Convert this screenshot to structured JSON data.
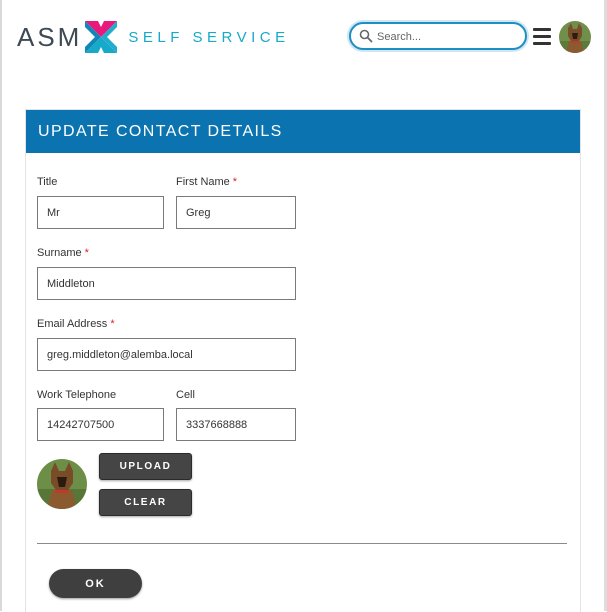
{
  "header": {
    "brand": "ASM",
    "brand_sub": "SELF SERVICE",
    "search_placeholder": "Search...",
    "brand_colors": {
      "dark": "#3d4a55",
      "pink": "#e8197d",
      "cyan": "#17a9c9"
    }
  },
  "form": {
    "title": "UPDATE CONTACT DETAILS",
    "header_color": "#0b74b0",
    "fields": {
      "title": {
        "label": "Title",
        "value": "Mr",
        "required": false
      },
      "first_name": {
        "label": "First Name",
        "value": "Greg",
        "required": true
      },
      "surname": {
        "label": "Surname",
        "value": "Middleton",
        "required": true
      },
      "email": {
        "label": "Email Address",
        "value": "greg.middleton@alemba.local",
        "required": true
      },
      "work_telephone": {
        "label": "Work Telephone",
        "value": "14242707500",
        "required": false
      },
      "cell": {
        "label": "Cell",
        "value": "3337668888",
        "required": false
      }
    },
    "required_marker": "*",
    "upload_label": "UPLOAD",
    "clear_label": "CLEAR",
    "ok_label": "OK"
  },
  "icons": {
    "search": "search-icon",
    "menu": "hamburger-menu-icon",
    "avatar": "user-avatar"
  }
}
